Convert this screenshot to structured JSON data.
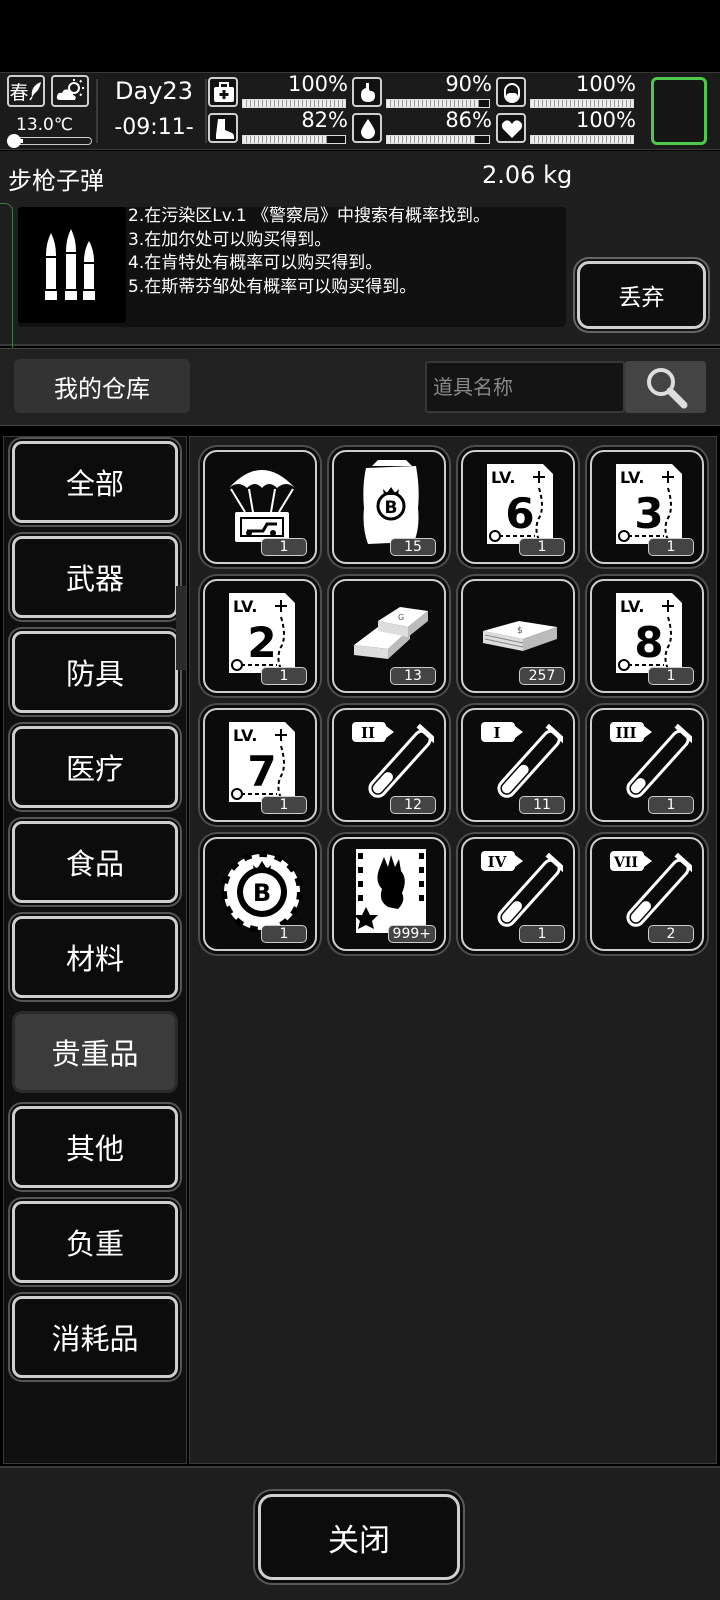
{
  "status": {
    "season": "春",
    "temperature": "13.0℃",
    "temperature_level": 0.1,
    "day": "Day23",
    "clock": "-09:11-",
    "stats": [
      {
        "icon": "medkit-icon",
        "value": "100%",
        "fill": 1.0
      },
      {
        "icon": "stomach-icon",
        "value": "90%",
        "fill": 0.9
      },
      {
        "icon": "bladder-icon",
        "value": "100%",
        "fill": 1.0
      },
      {
        "icon": "boot-icon",
        "value": "82%",
        "fill": 0.82
      },
      {
        "icon": "water-drop-icon",
        "value": "86%",
        "fill": 0.86
      },
      {
        "icon": "heart-icon",
        "value": "100%",
        "fill": 1.0
      }
    ]
  },
  "detail": {
    "name": "步枪子弹",
    "weight": "2.06 kg",
    "icon": "rifle-ammo-icon",
    "lines": [
      "2.在污染区Lv.1 《警察局》中搜索有概率找到。",
      "3.在加尔处可以购买得到。",
      "4.在肯特处有概率可以购买得到。",
      "5.在斯蒂芬邹处有概率可以购买得到。"
    ],
    "discard_label": "丢弃"
  },
  "warehouse": {
    "title": "我的仓库",
    "search_placeholder": "道具名称"
  },
  "categories": [
    {
      "label": "全部",
      "selected": false
    },
    {
      "label": "武器",
      "selected": false
    },
    {
      "label": "防具",
      "selected": false
    },
    {
      "label": "医疗",
      "selected": false
    },
    {
      "label": "食品",
      "selected": false
    },
    {
      "label": "材料",
      "selected": false
    },
    {
      "label": "贵重品",
      "selected": true
    },
    {
      "label": "其他",
      "selected": false
    },
    {
      "label": "负重",
      "selected": false
    },
    {
      "label": "消耗品",
      "selected": false
    }
  ],
  "items": [
    {
      "icon": "airdrop-crate-icon",
      "count": "1"
    },
    {
      "icon": "coin-bag-icon",
      "count": "15"
    },
    {
      "icon": "map-lv6-icon",
      "level": "6",
      "count": "1"
    },
    {
      "icon": "map-lv3-icon",
      "level": "3",
      "count": "1"
    },
    {
      "icon": "map-lv2-icon",
      "level": "2",
      "count": "1"
    },
    {
      "icon": "gold-bars-icon",
      "count": "13"
    },
    {
      "icon": "cash-stack-icon",
      "count": "257"
    },
    {
      "icon": "map-lv8-icon",
      "level": "8",
      "count": "1"
    },
    {
      "icon": "map-lv7-icon",
      "level": "7",
      "count": "1"
    },
    {
      "icon": "test-tube-ii-icon",
      "numeral": "II",
      "fill": 0.3,
      "count": "12"
    },
    {
      "icon": "test-tube-i-icon",
      "numeral": "I",
      "fill": 0.45,
      "count": "11"
    },
    {
      "icon": "test-tube-iii-icon",
      "numeral": "III",
      "fill": 0.2,
      "count": "1"
    },
    {
      "icon": "casino-chip-icon",
      "count": "1"
    },
    {
      "icon": "zombie-hand-card-icon",
      "count": "999+"
    },
    {
      "icon": "test-tube-iv-icon",
      "numeral": "IV",
      "fill": 0.3,
      "count": "1"
    },
    {
      "icon": "test-tube-vii-icon",
      "numeral": "VII",
      "fill": 0.3,
      "count": "2"
    }
  ],
  "footer": {
    "close_label": "关闭"
  }
}
